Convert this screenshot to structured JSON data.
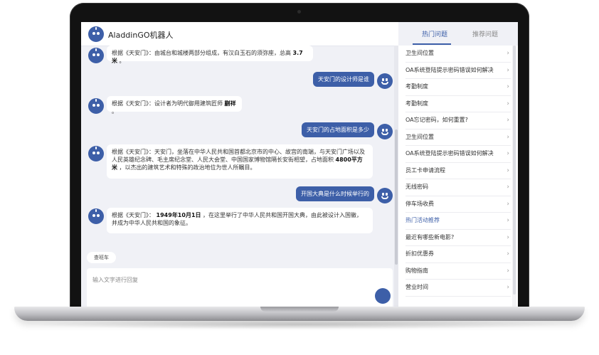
{
  "header": {
    "title": "AladdinGO机器人"
  },
  "messages": {
    "m1": {
      "prefix": "根据《天安门》：由城台和城楼两部分组成，有汉白玉石的须弥座，总高 ",
      "bold": "3.7米",
      "suffix": " 。"
    },
    "u1": "天安门的设计师是谁",
    "m2": {
      "prefix": "根据《天安门》：设计者为明代御用建筑匠师 ",
      "bold": "蒯祥",
      "suffix": " 。"
    },
    "u2": "天安门的占地面积是多少",
    "m3": {
      "prefix": "根据《天安门》：天安门，坐落在中华人民共和国首都北京市的中心、故宫的南端，与天安门广场以及人民英雄纪念碑、毛主席纪念堂、人民大会堂、中国国家博物馆隔长安街相望，占地面积 ",
      "bold": "4800平方米",
      "suffix": " ，以杰出的建筑艺术和特殊的政治地位为世人所瞩目。"
    },
    "u3": "开国大典是什么时候举行的",
    "m4": {
      "prefix": "根据《天安门》： ",
      "bold": "1949年10月1日",
      "suffix": " ，在这里举行了中华人民共和国开国大典，由此被设计入国徽，并成为中华人民共和国的象征。"
    }
  },
  "chip": "查班车",
  "input": {
    "placeholder": "输入文字进行回复"
  },
  "tabs": {
    "hot": "热门问题",
    "recommend": "推荐问题"
  },
  "questions": [
    "卫生间位置",
    "OA系统登陆提示密码错误如何解决",
    "考勤制度",
    "考勤制度",
    "OA忘记密码，如何重置?",
    "卫生间位置",
    "OA系统登陆提示密码错误如何解决",
    "员工卡申请流程",
    "无线密码",
    "停车场收费",
    "热门活动推荐",
    "最近有哪些新电影?",
    "折扣优惠券",
    "购物指南",
    "营业时间"
  ],
  "colors": {
    "accent": "#3d5fa8",
    "background": "#f0f1f6"
  }
}
